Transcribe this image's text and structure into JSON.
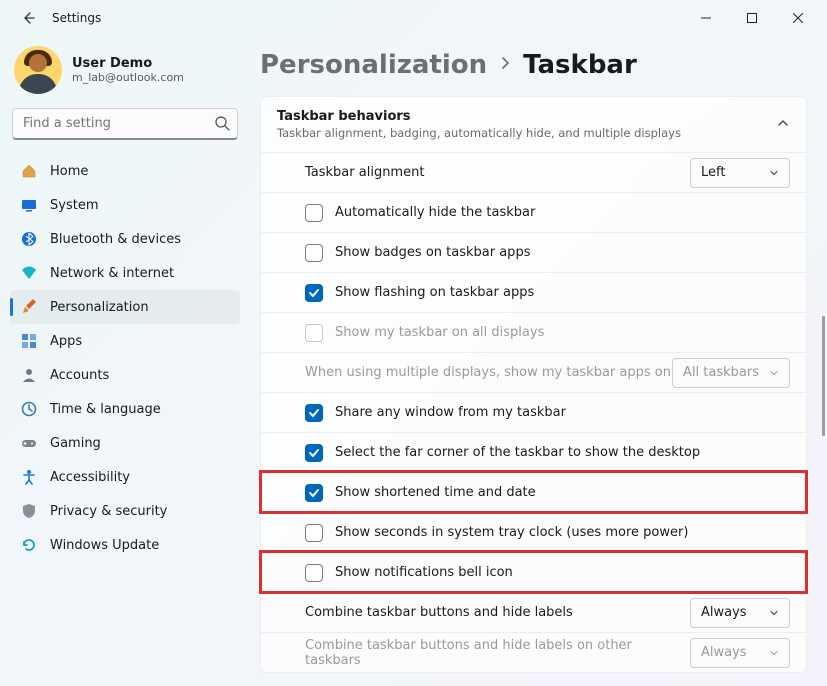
{
  "window": {
    "title": "Settings"
  },
  "profile": {
    "name": "User Demo",
    "email": "m_lab@outlook.com"
  },
  "search": {
    "placeholder": "Find a setting"
  },
  "nav": {
    "home": "Home",
    "system": "System",
    "bluetooth": "Bluetooth & devices",
    "network": "Network & internet",
    "personalization": "Personalization",
    "apps": "Apps",
    "accounts": "Accounts",
    "time": "Time & language",
    "gaming": "Gaming",
    "accessibility": "Accessibility",
    "privacy": "Privacy & security",
    "update": "Windows Update"
  },
  "breadcrumb": {
    "parent": "Personalization",
    "current": "Taskbar"
  },
  "card": {
    "title": "Taskbar behaviors",
    "subtitle": "Taskbar alignment, badging, automatically hide, and multiple displays"
  },
  "rows": {
    "alignment": {
      "label": "Taskbar alignment",
      "value": "Left"
    },
    "autohide": {
      "label": "Automatically hide the taskbar",
      "checked": false
    },
    "badges": {
      "label": "Show badges on taskbar apps",
      "checked": false
    },
    "flashing": {
      "label": "Show flashing on taskbar apps",
      "checked": true
    },
    "all_displays": {
      "label": "Show my taskbar on all displays",
      "checked": false,
      "disabled": true
    },
    "multi_where": {
      "label": "When using multiple displays, show my taskbar apps on",
      "value": "All taskbars",
      "disabled": true
    },
    "share": {
      "label": "Share any window from my taskbar",
      "checked": true
    },
    "far_corner": {
      "label": "Select the far corner of the taskbar to show the desktop",
      "checked": true
    },
    "short_time": {
      "label": "Show shortened time and date",
      "checked": true
    },
    "seconds": {
      "label": "Show seconds in system tray clock (uses more power)",
      "checked": false
    },
    "bell": {
      "label": "Show notifications bell icon",
      "checked": false
    },
    "combine": {
      "label": "Combine taskbar buttons and hide labels",
      "value": "Always"
    },
    "combine_other": {
      "label": "Combine taskbar buttons and hide labels on other taskbars",
      "value": "Always",
      "disabled": true
    }
  }
}
